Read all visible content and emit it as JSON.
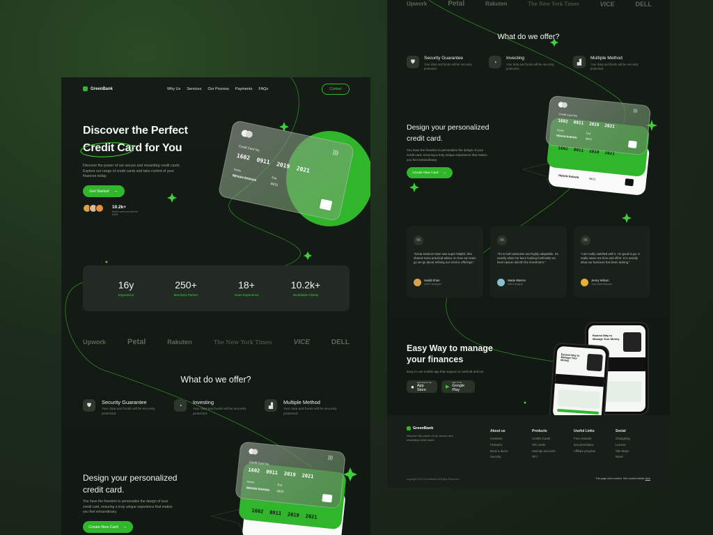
{
  "brand": {
    "name": "GreenBank"
  },
  "nav": {
    "items": [
      "Why Us",
      "Services",
      "Our Process",
      "Payments",
      "FAQs"
    ],
    "contact": "Contact"
  },
  "hero": {
    "title_line1": "Discover the Perfect",
    "title_highlight": "Credit Card",
    "title_rest": " for You",
    "description": "Discover the power of our secure and rewarding credit cards. Explore our range of credit cards and take control of your finances today.",
    "cta": "Get Started",
    "users_count": "10.2k+",
    "users_label": "Active users around the world"
  },
  "hero_card": {
    "label": "Credit Card No.",
    "number": [
      "1602",
      "0911",
      "2019",
      "2021"
    ],
    "name_label": "Name",
    "name": "REHAN RAIHAN",
    "exp_label": "Exp.",
    "exp": "09/11"
  },
  "stats": [
    {
      "value": "16y",
      "label": "Experience"
    },
    {
      "value": "250+",
      "label": "Merchant Partner"
    },
    {
      "value": "18+",
      "label": "Years Experience"
    },
    {
      "value": "10.2k+",
      "label": "Worldwide Clients"
    }
  ],
  "partner_logos": [
    "Upwork",
    "Petal",
    "Rakuten",
    "The New York Times",
    "VICE",
    "DELL"
  ],
  "offer": {
    "title": "What do we offer?",
    "features": [
      {
        "icon": "shield-icon",
        "title": "Security Guarantee",
        "desc": "Your data and funds will be securely protected."
      },
      {
        "icon": "pie-chart-icon",
        "title": "Investing",
        "desc": "Your data and funds will be securely protected."
      },
      {
        "icon": "bar-chart-icon",
        "title": "Multiple Method",
        "desc": "Your data and funds will be securely protected."
      }
    ]
  },
  "design": {
    "title": "Design your personalized credit card.",
    "title_line1": "Design your personalized",
    "title_line2": "credit card.",
    "desc": "You have the freedom to personalize the design of your credit card, ensuring a truly unique experience that makes you feel extraordinary.",
    "cta": "Create New Card"
  },
  "testimonials": [
    {
      "quote": "\"Great session! Dani was super helpful. She shared some practical advice on how can team go we go about refining our service offerings.\"",
      "name": "Hadid Khan",
      "role": "UI/UX Designer"
    },
    {
      "quote": "\"It's is both attractive and highly adaptable. It's exactly what I've been looking forsfiristily wo lorem ipsum dolorth the investment.\"",
      "name": "Wade Warren",
      "role": "Web Designer"
    },
    {
      "quote": "\"I am really satisfied with it. I'm good to go. It really saves me time and effort. It is exactly what our business has been lacking.\"",
      "name": "Jenny Wilson",
      "role": "Trust Administrator"
    }
  ],
  "easy": {
    "title_line1": "Easy Way to manage",
    "title_line2": "your finances",
    "desc": "Easy to use mobile app that support on android and ios.",
    "appstore_small": "Download on the",
    "appstore": "App Store",
    "gplay_small": "GET IT ON",
    "gplay": "Google Play"
  },
  "phone": {
    "headline": "Easiest Way to Manage Your Money"
  },
  "footer": {
    "brand": "GreenBank",
    "desc": "Discover the power of our secure and rewarding credit cards.",
    "columns": [
      {
        "title": "About us",
        "links": [
          "Investors",
          "Features",
          "Book a demo",
          "Security"
        ]
      },
      {
        "title": "Products",
        "links": [
          "Credits Cards",
          "Gift Cards",
          "Savings accounts",
          "NFT"
        ]
      },
      {
        "title": "Useful Links",
        "links": [
          "Free rewards",
          "Documentation",
          "Affiliate program"
        ]
      },
      {
        "title": "Social",
        "links": [
          "Changelog",
          "License",
          "Site Maps",
          "News"
        ]
      }
    ],
    "copyright": "copyright 2023 GreenBank All Rights Reserved",
    "cookie": "This page uses cookies. See cookies details",
    "cookie_link": "here"
  },
  "colors": {
    "accent": "#2fb62b",
    "bg": "#141a14"
  }
}
